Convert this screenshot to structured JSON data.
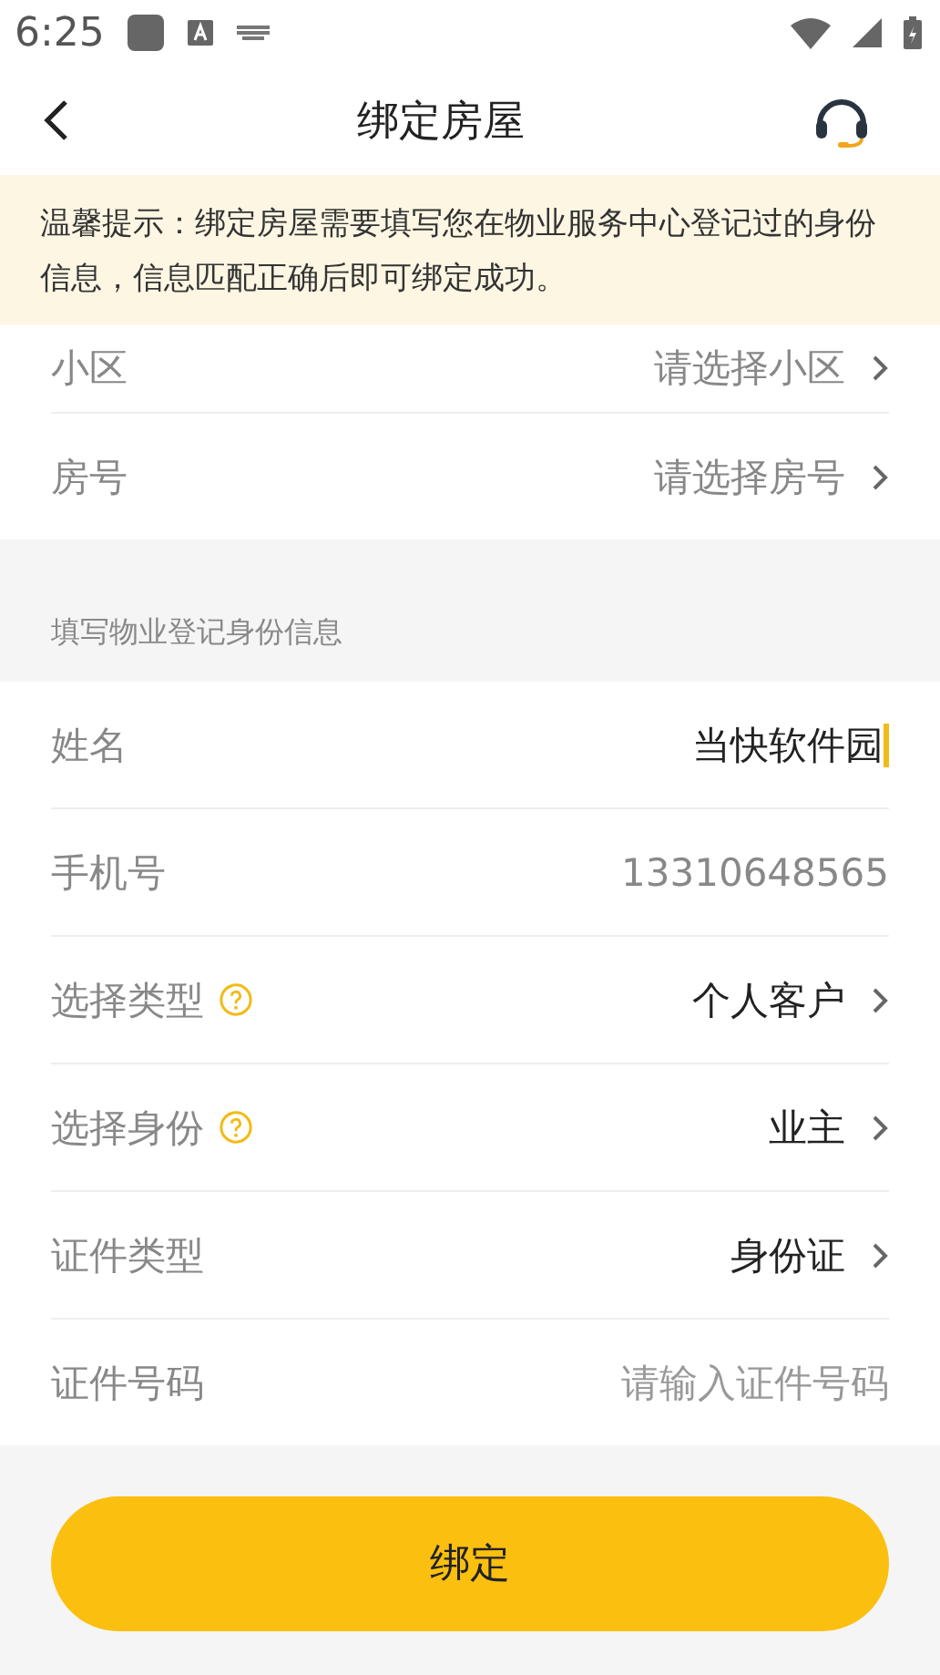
{
  "status_bar": {
    "time": "6:25"
  },
  "nav": {
    "title": "绑定房屋"
  },
  "notice": {
    "text": "温馨提示：绑定房屋需要填写您在物业服务中心登记过的身份信息，信息匹配正确后即可绑定成功。"
  },
  "house_rows": [
    {
      "label": "小区",
      "kind": "select",
      "placeholder": "请选择小区"
    },
    {
      "label": "房号",
      "kind": "select",
      "placeholder": "请选择房号"
    }
  ],
  "section_header": "填写物业登记身份信息",
  "identity_rows": [
    {
      "label": "姓名",
      "kind": "input",
      "value": "当快软件园",
      "help": false,
      "disabled": false,
      "focused": true
    },
    {
      "label": "手机号",
      "kind": "input",
      "value": "13310648565",
      "help": false,
      "disabled": true,
      "focused": false
    },
    {
      "label": "选择类型",
      "kind": "select",
      "value": "个人客户",
      "help": true
    },
    {
      "label": "选择身份",
      "kind": "select",
      "value": "业主",
      "help": true
    },
    {
      "label": "证件类型",
      "kind": "select",
      "value": "身份证",
      "help": false
    },
    {
      "label": "证件号码",
      "kind": "input",
      "placeholder": "请输入证件号码",
      "help": false,
      "disabled": false,
      "focused": false
    }
  ],
  "submit_button": "绑定"
}
